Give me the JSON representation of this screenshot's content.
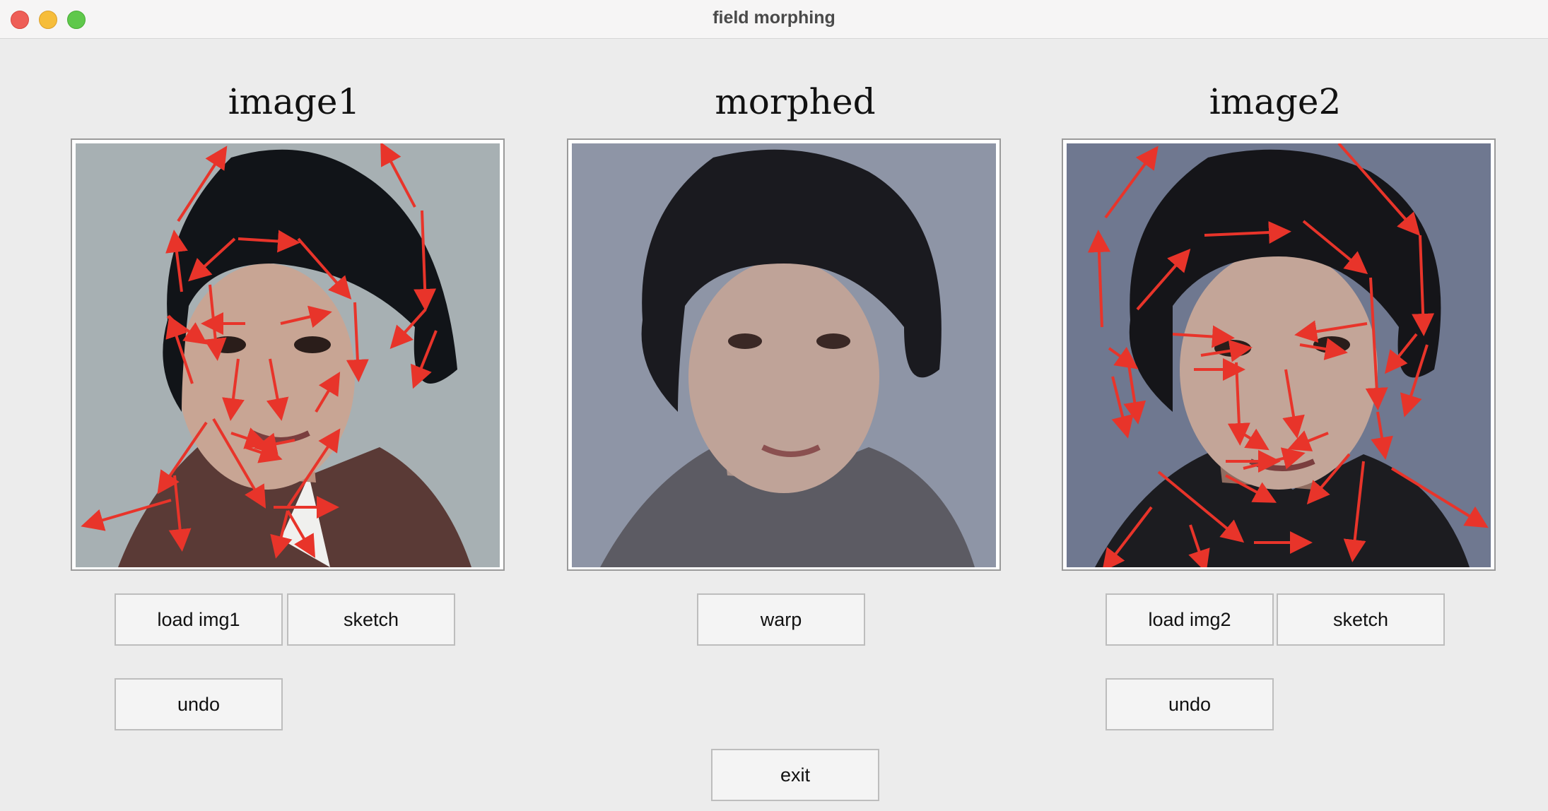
{
  "window": {
    "title": "field morphing"
  },
  "panels": {
    "left": {
      "title": "image1"
    },
    "center": {
      "title": "morphed"
    },
    "right": {
      "title": "image2"
    }
  },
  "buttons": {
    "load_img1": "load img1",
    "sketch1": "sketch",
    "undo1": "undo",
    "warp": "warp",
    "load_img2": "load img2",
    "sketch2": "sketch",
    "undo2": "undo",
    "exit": "exit"
  },
  "colors": {
    "arrow": "#e8342a",
    "background": "#ececec"
  }
}
